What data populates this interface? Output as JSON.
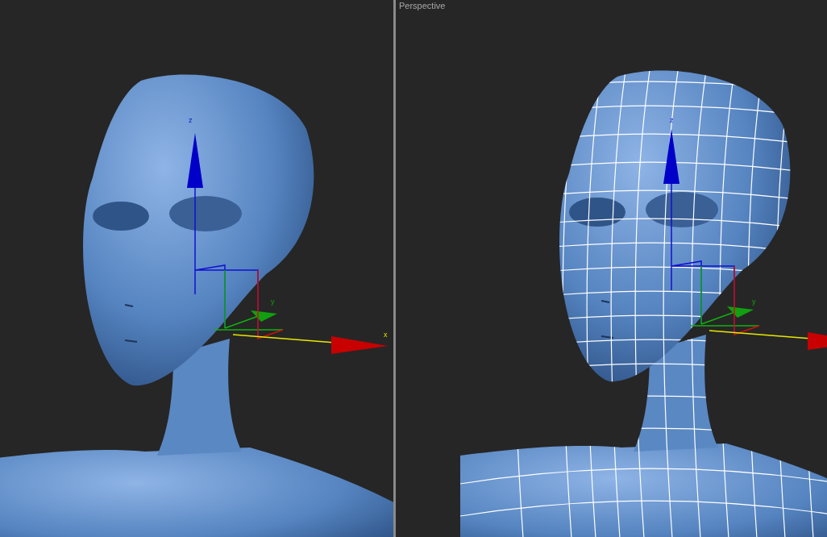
{
  "viewports": [
    {
      "kind": "shaded",
      "axis_labels": [
        "z",
        "y",
        "x"
      ]
    },
    {
      "kind": "wireframe",
      "label": "Perspective",
      "axis_labels": [
        "z",
        "y"
      ]
    }
  ]
}
